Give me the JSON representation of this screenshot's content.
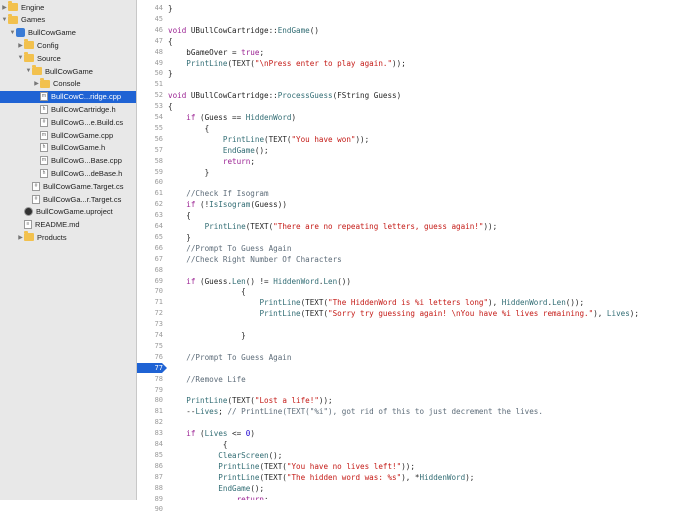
{
  "colors": {
    "sidebar_bg": "#e8e8e8",
    "selection": "#1f63d4",
    "folder": "#f2c14e",
    "keyword": "#9b2393",
    "string": "#c41a16",
    "function": "#326d74",
    "comment": "#5d6c79",
    "number": "#1c00cf",
    "plain": "#262626"
  },
  "navigator": {
    "items": [
      {
        "label": "Engine",
        "icon": "folder-icon",
        "depth": 0,
        "disclosure": "collapsed"
      },
      {
        "label": "Games",
        "icon": "folder-icon",
        "depth": 0,
        "disclosure": "expanded"
      },
      {
        "label": "BullCowGame",
        "icon": "project-icon",
        "depth": 1,
        "disclosure": "expanded"
      },
      {
        "label": "Config",
        "icon": "folder-icon",
        "depth": 2,
        "disclosure": "collapsed"
      },
      {
        "label": "Source",
        "icon": "folder-icon",
        "depth": 2,
        "disclosure": "expanded"
      },
      {
        "label": "BullCowGame",
        "icon": "folder-icon",
        "depth": 3,
        "disclosure": "expanded"
      },
      {
        "label": "Console",
        "icon": "folder-icon",
        "depth": 4,
        "disclosure": "collapsed"
      },
      {
        "label": "BullCowC...ridge.cpp",
        "icon": "cpp-file-icon",
        "depth": 4,
        "selected": true
      },
      {
        "label": "BullCowCartridge.h",
        "icon": "header-file-icon",
        "depth": 4
      },
      {
        "label": "BullCowG...e.Build.cs",
        "icon": "cs-file-icon",
        "depth": 4
      },
      {
        "label": "BullCowGame.cpp",
        "icon": "cpp-file-icon",
        "depth": 4
      },
      {
        "label": "BullCowGame.h",
        "icon": "header-file-icon",
        "depth": 4
      },
      {
        "label": "BullCowG...Base.cpp",
        "icon": "cpp-file-icon",
        "depth": 4
      },
      {
        "label": "BullCowG...deBase.h",
        "icon": "header-file-icon",
        "depth": 4
      },
      {
        "label": "BullCowGame.Target.cs",
        "icon": "cs-file-icon",
        "depth": 3
      },
      {
        "label": "BullCowGa...r.Target.cs",
        "icon": "cs-file-icon",
        "depth": 3
      },
      {
        "label": "BullCowGame.uproject",
        "icon": "uproject-icon",
        "depth": 2
      },
      {
        "label": "README.md",
        "icon": "markdown-file-icon",
        "depth": 2
      },
      {
        "label": "Products",
        "icon": "folder-icon",
        "depth": 2,
        "disclosure": "collapsed"
      }
    ]
  },
  "editor": {
    "current_line": 77,
    "lines": [
      {
        "n": 44,
        "tokens": [
          {
            "t": "}",
            "c": "tx"
          }
        ]
      },
      {
        "n": 45,
        "tokens": []
      },
      {
        "n": 46,
        "tokens": [
          {
            "t": "void ",
            "c": "kw"
          },
          {
            "t": "UBullCowCartridge::",
            "c": "tx"
          },
          {
            "t": "EndGame",
            "c": "fn"
          },
          {
            "t": "()",
            "c": "tx"
          }
        ]
      },
      {
        "n": 47,
        "tokens": [
          {
            "t": "{",
            "c": "tx"
          }
        ]
      },
      {
        "n": 48,
        "tokens": [
          {
            "t": "    bGameOver = ",
            "c": "tx"
          },
          {
            "t": "true",
            "c": "kw"
          },
          {
            "t": ";",
            "c": "tx"
          }
        ]
      },
      {
        "n": 49,
        "tokens": [
          {
            "t": "    ",
            "c": "tx"
          },
          {
            "t": "PrintLine",
            "c": "fn"
          },
          {
            "t": "(TEXT(",
            "c": "tx"
          },
          {
            "t": "\"\\nPress enter to play again.\"",
            "c": "str"
          },
          {
            "t": "));",
            "c": "tx"
          }
        ]
      },
      {
        "n": 50,
        "tokens": [
          {
            "t": "}",
            "c": "tx"
          }
        ]
      },
      {
        "n": 51,
        "tokens": []
      },
      {
        "n": 52,
        "tokens": [
          {
            "t": "void ",
            "c": "kw"
          },
          {
            "t": "UBullCowCartridge::",
            "c": "tx"
          },
          {
            "t": "ProcessGuess",
            "c": "fn"
          },
          {
            "t": "(FString Guess)",
            "c": "tx"
          }
        ]
      },
      {
        "n": 53,
        "tokens": [
          {
            "t": "{",
            "c": "tx"
          }
        ]
      },
      {
        "n": 54,
        "tokens": [
          {
            "t": "    ",
            "c": "tx"
          },
          {
            "t": "if",
            "c": "kw"
          },
          {
            "t": " (Guess == ",
            "c": "tx"
          },
          {
            "t": "HiddenWord",
            "c": "fn"
          },
          {
            "t": ")",
            "c": "tx"
          }
        ]
      },
      {
        "n": 55,
        "tokens": [
          {
            "t": "        {",
            "c": "tx"
          }
        ]
      },
      {
        "n": 56,
        "tokens": [
          {
            "t": "            ",
            "c": "tx"
          },
          {
            "t": "PrintLine",
            "c": "fn"
          },
          {
            "t": "(TEXT(",
            "c": "tx"
          },
          {
            "t": "\"You have won\"",
            "c": "str"
          },
          {
            "t": "));",
            "c": "tx"
          }
        ]
      },
      {
        "n": 57,
        "tokens": [
          {
            "t": "            ",
            "c": "tx"
          },
          {
            "t": "EndGame",
            "c": "fn"
          },
          {
            "t": "();",
            "c": "tx"
          }
        ]
      },
      {
        "n": 58,
        "tokens": [
          {
            "t": "            ",
            "c": "tx"
          },
          {
            "t": "return",
            "c": "kw"
          },
          {
            "t": ";",
            "c": "tx"
          }
        ]
      },
      {
        "n": 59,
        "tokens": [
          {
            "t": "        }",
            "c": "tx"
          }
        ]
      },
      {
        "n": 60,
        "tokens": []
      },
      {
        "n": 61,
        "tokens": [
          {
            "t": "    //Check If Isogram",
            "c": "cm"
          }
        ]
      },
      {
        "n": 62,
        "tokens": [
          {
            "t": "    ",
            "c": "tx"
          },
          {
            "t": "if",
            "c": "kw"
          },
          {
            "t": " (!",
            "c": "tx"
          },
          {
            "t": "IsIsogram",
            "c": "fn"
          },
          {
            "t": "(Guess))",
            "c": "tx"
          }
        ]
      },
      {
        "n": 63,
        "tokens": [
          {
            "t": "    {",
            "c": "tx"
          }
        ]
      },
      {
        "n": 64,
        "tokens": [
          {
            "t": "        ",
            "c": "tx"
          },
          {
            "t": "PrintLine",
            "c": "fn"
          },
          {
            "t": "(TEXT(",
            "c": "tx"
          },
          {
            "t": "\"There are no repeating letters, guess again!\"",
            "c": "str"
          },
          {
            "t": "));",
            "c": "tx"
          }
        ]
      },
      {
        "n": 65,
        "tokens": [
          {
            "t": "    }",
            "c": "tx"
          }
        ]
      },
      {
        "n": 66,
        "tokens": [
          {
            "t": "    //Prompt To Guess Again",
            "c": "cm"
          }
        ]
      },
      {
        "n": 67,
        "tokens": [
          {
            "t": "    //Check Right Number Of Characters",
            "c": "cm"
          }
        ]
      },
      {
        "n": 68,
        "tokens": []
      },
      {
        "n": 69,
        "tokens": [
          {
            "t": "    ",
            "c": "tx"
          },
          {
            "t": "if",
            "c": "kw"
          },
          {
            "t": " (Guess.",
            "c": "tx"
          },
          {
            "t": "Len",
            "c": "fn"
          },
          {
            "t": "() != ",
            "c": "tx"
          },
          {
            "t": "HiddenWord",
            "c": "fn"
          },
          {
            "t": ".",
            "c": "tx"
          },
          {
            "t": "Len",
            "c": "fn"
          },
          {
            "t": "())",
            "c": "tx"
          }
        ]
      },
      {
        "n": 70,
        "tokens": [
          {
            "t": "                {",
            "c": "tx"
          }
        ]
      },
      {
        "n": 71,
        "tokens": [
          {
            "t": "                    ",
            "c": "tx"
          },
          {
            "t": "PrintLine",
            "c": "fn"
          },
          {
            "t": "(TEXT(",
            "c": "tx"
          },
          {
            "t": "\"The HiddenWord is %i letters long\"",
            "c": "str"
          },
          {
            "t": "), ",
            "c": "tx"
          },
          {
            "t": "HiddenWord",
            "c": "fn"
          },
          {
            "t": ".",
            "c": "tx"
          },
          {
            "t": "Len",
            "c": "fn"
          },
          {
            "t": "());",
            "c": "tx"
          }
        ]
      },
      {
        "n": 72,
        "tokens": [
          {
            "t": "                    ",
            "c": "tx"
          },
          {
            "t": "PrintLine",
            "c": "fn"
          },
          {
            "t": "(TEXT(",
            "c": "tx"
          },
          {
            "t": "\"Sorry try guessing again! \\nYou have %i lives remaining.\"",
            "c": "str"
          },
          {
            "t": "), ",
            "c": "tx"
          },
          {
            "t": "Lives",
            "c": "fn"
          },
          {
            "t": ");",
            "c": "tx"
          }
        ]
      },
      {
        "n": 73,
        "tokens": []
      },
      {
        "n": 74,
        "tokens": [
          {
            "t": "                }",
            "c": "tx"
          }
        ]
      },
      {
        "n": 75,
        "tokens": []
      },
      {
        "n": 76,
        "tokens": [
          {
            "t": "    //Prompt To Guess Again",
            "c": "cm"
          }
        ]
      },
      {
        "n": 77,
        "tokens": []
      },
      {
        "n": 78,
        "tokens": [
          {
            "t": "    //Remove Life",
            "c": "cm"
          }
        ]
      },
      {
        "n": 79,
        "tokens": []
      },
      {
        "n": 80,
        "tokens": [
          {
            "t": "    ",
            "c": "tx"
          },
          {
            "t": "PrintLine",
            "c": "fn"
          },
          {
            "t": "(TEXT(",
            "c": "tx"
          },
          {
            "t": "\"Lost a life!\"",
            "c": "str"
          },
          {
            "t": "));",
            "c": "tx"
          }
        ]
      },
      {
        "n": 81,
        "tokens": [
          {
            "t": "    --",
            "c": "tx"
          },
          {
            "t": "Lives",
            "c": "fn"
          },
          {
            "t": "; ",
            "c": "tx"
          },
          {
            "t": "// PrintLine(TEXT(\"%i\"), got rid of this to just decrement the lives.",
            "c": "cm"
          }
        ]
      },
      {
        "n": 82,
        "tokens": []
      },
      {
        "n": 83,
        "tokens": [
          {
            "t": "    ",
            "c": "tx"
          },
          {
            "t": "if",
            "c": "kw"
          },
          {
            "t": " (",
            "c": "tx"
          },
          {
            "t": "Lives",
            "c": "fn"
          },
          {
            "t": " <= ",
            "c": "tx"
          },
          {
            "t": "0",
            "c": "num"
          },
          {
            "t": ")",
            "c": "tx"
          }
        ]
      },
      {
        "n": 84,
        "tokens": [
          {
            "t": "            {",
            "c": "tx"
          }
        ]
      },
      {
        "n": 85,
        "tokens": [
          {
            "t": "           ",
            "c": "tx"
          },
          {
            "t": "ClearScreen",
            "c": "fn"
          },
          {
            "t": "();",
            "c": "tx"
          }
        ]
      },
      {
        "n": 86,
        "tokens": [
          {
            "t": "           ",
            "c": "tx"
          },
          {
            "t": "PrintLine",
            "c": "fn"
          },
          {
            "t": "(TEXT(",
            "c": "tx"
          },
          {
            "t": "\"You have no lives left!\"",
            "c": "str"
          },
          {
            "t": "));",
            "c": "tx"
          }
        ]
      },
      {
        "n": 87,
        "tokens": [
          {
            "t": "           ",
            "c": "tx"
          },
          {
            "t": "PrintLine",
            "c": "fn"
          },
          {
            "t": "(TEXT(",
            "c": "tx"
          },
          {
            "t": "\"The hidden word was: %s\"",
            "c": "str"
          },
          {
            "t": "), *",
            "c": "tx"
          },
          {
            "t": "HiddenWord",
            "c": "fn"
          },
          {
            "t": ");",
            "c": "tx"
          }
        ]
      },
      {
        "n": 88,
        "tokens": [
          {
            "t": "           ",
            "c": "tx"
          },
          {
            "t": "EndGame",
            "c": "fn"
          },
          {
            "t": "();",
            "c": "tx"
          }
        ]
      },
      {
        "n": 89,
        "tokens": [
          {
            "t": "               ",
            "c": "tx"
          },
          {
            "t": "return",
            "c": "kw"
          },
          {
            "t": ";",
            "c": "tx"
          }
        ]
      },
      {
        "n": 90,
        "tokens": [
          {
            "t": "            }",
            "c": "tx"
          }
        ]
      }
    ]
  }
}
